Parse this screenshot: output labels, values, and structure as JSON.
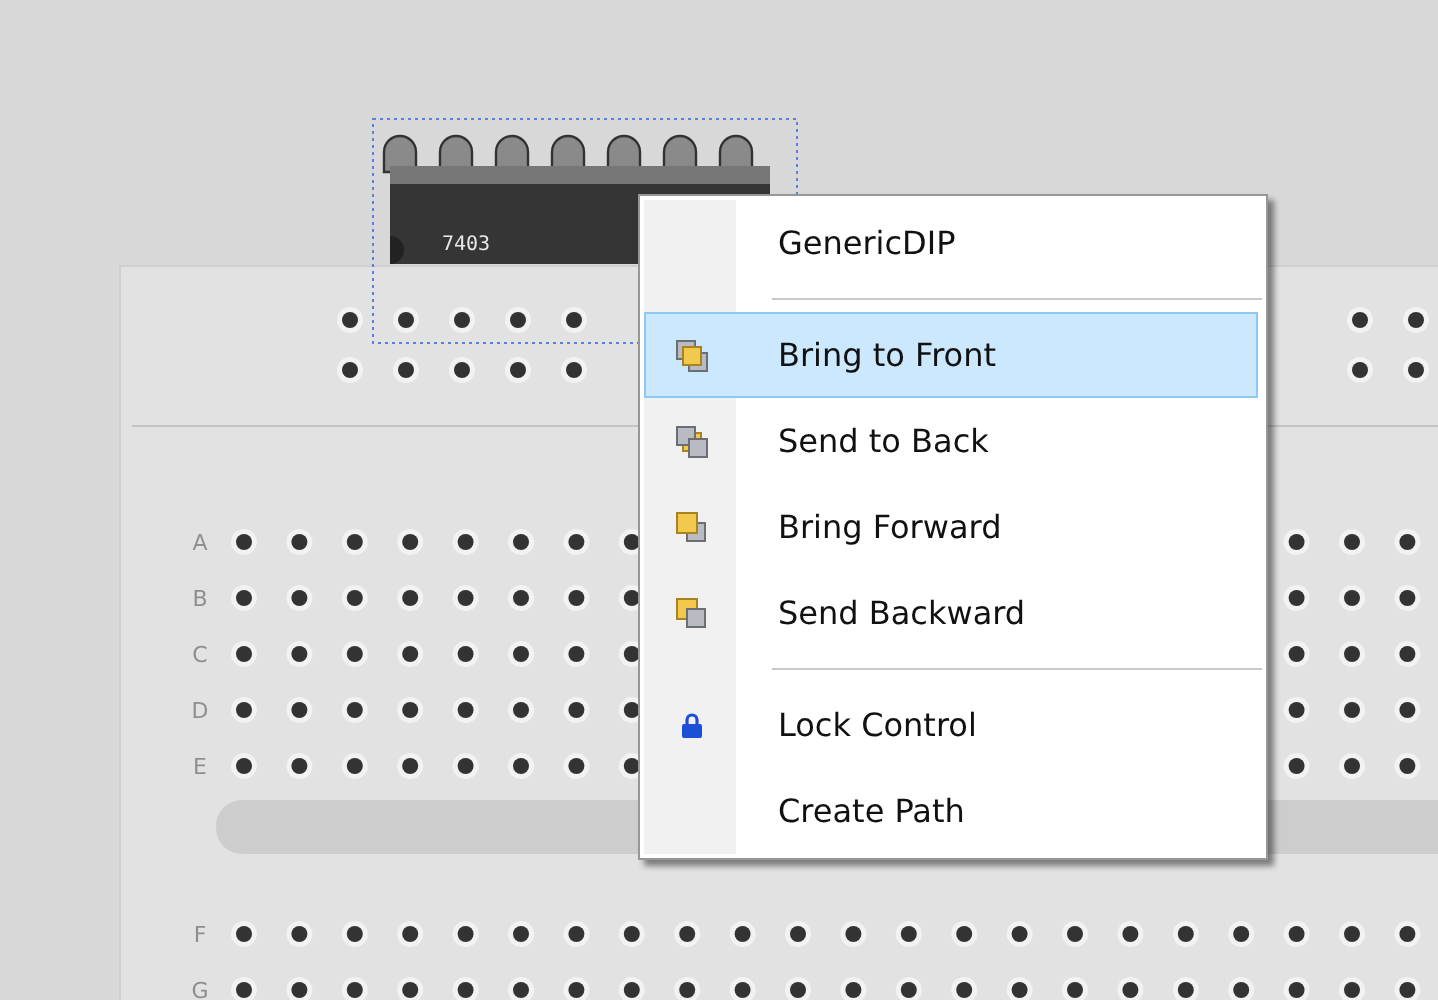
{
  "chip": {
    "label": "7403",
    "selected": true
  },
  "breadboard": {
    "row_labels": [
      "A",
      "B",
      "C",
      "D",
      "E",
      "F",
      "G"
    ]
  },
  "context_menu": {
    "items": [
      {
        "kind": "plain",
        "label": "GenericDIP",
        "selected": false
      },
      {
        "kind": "separator"
      },
      {
        "kind": "front",
        "label": "Bring to Front",
        "selected": true
      },
      {
        "kind": "back",
        "label": "Send to Back",
        "selected": false
      },
      {
        "kind": "forward",
        "label": "Bring Forward",
        "selected": false
      },
      {
        "kind": "backward",
        "label": "Send Backward",
        "selected": false
      },
      {
        "kind": "separator"
      },
      {
        "kind": "lock",
        "label": "Lock Control",
        "selected": false
      },
      {
        "kind": "plain",
        "label": "Create Path",
        "selected": false
      }
    ]
  }
}
